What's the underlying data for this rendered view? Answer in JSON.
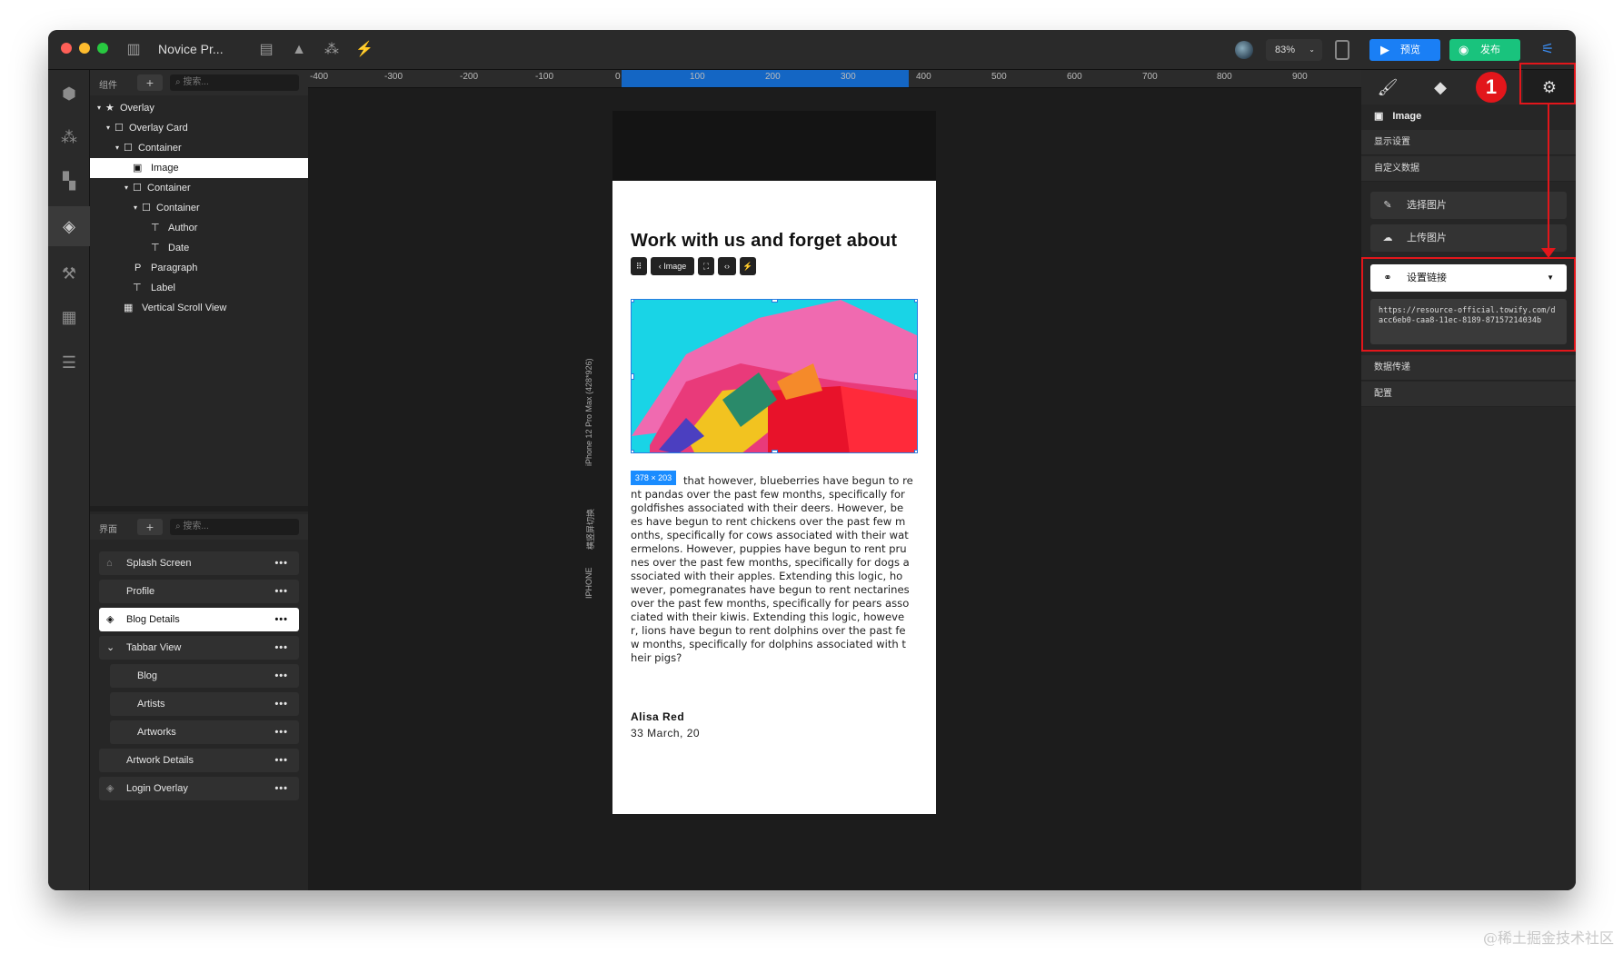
{
  "titlebar": {
    "title": "Novice Pr...",
    "zoom": "83%",
    "preview": "预览",
    "publish": "发布"
  },
  "components": {
    "header": "组件",
    "search_placeholder": "搜索...",
    "tree": [
      "Overlay",
      "Overlay Card",
      "Container",
      "Image",
      "Container",
      "Container",
      "Author",
      "Date",
      "Paragraph",
      "Label",
      "Vertical Scroll View"
    ]
  },
  "screens": {
    "header": "界面",
    "search_placeholder": "搜索...",
    "items": [
      "Splash Screen",
      "Profile",
      "Blog Details",
      "Tabbar View",
      "Blog",
      "Artists",
      "Artworks",
      "Artwork Details",
      "Login Overlay"
    ]
  },
  "ruler": {
    "ticks": [
      "-400",
      "-300",
      "-200",
      "-100",
      "0",
      "100",
      "200",
      "300",
      "400",
      "500",
      "600",
      "700",
      "800",
      "900"
    ]
  },
  "device": {
    "name": "iPhone 12 Pro Max (428*926)",
    "orientation": "横竖屏切换",
    "type": "IPHONE"
  },
  "phone": {
    "heading": "Work with us and forget about",
    "toolbar_label": "Image",
    "size_badge": "378 × 203",
    "paragraph": "that however, blueberries have begun to re\nnt pandas over the past few months, specifically for\ngoldfishes associated with their deers. However, be\nes have begun to rent chickens over the past few m\nonths, specifically for cows associated with their wat\nermelons. However, puppies have begun to rent pru\nnes over the past few months, specifically for dogs a\nssociated with their apples. Extending this logic, ho\nwever, pomegranates have begun to rent nectarines\nover the past few months, specifically for pears asso\nciated with their kiwis. Extending this logic, howeve\nr, lions have begun to rent dolphins over the past fe\nw months, specifically for dolphins associated with t\nheir pigs?",
    "author": "Alisa Red",
    "date": "33 March, 20"
  },
  "inspector": {
    "element": "Image",
    "display_settings": "显示设置",
    "custom_data": "自定义数据",
    "choose_image": "选择图片",
    "upload_image": "上传图片",
    "set_link": "设置链接",
    "url": "https://resource-official.towify.com/dacc6eb0-caa8-11ec-8189-87157214034b",
    "data_transfer": "数据传递",
    "config": "配置",
    "step": "1"
  },
  "watermark": "@稀土掘金技术社区",
  "colors": {
    "accent": "#1a8cff",
    "preview": "#1a7ff5",
    "publish": "#19c37d",
    "annotation": "#e2161b"
  }
}
